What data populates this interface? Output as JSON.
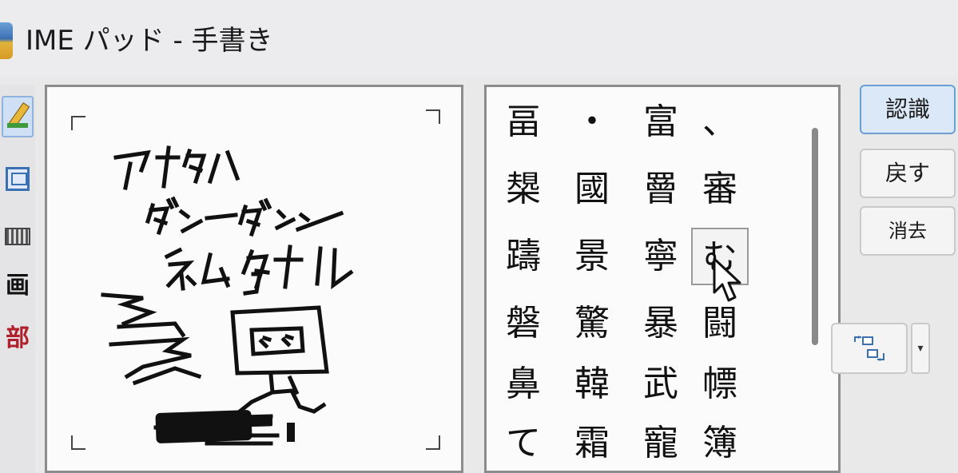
{
  "window": {
    "title": "IME パッド - 手書き"
  },
  "toolstrip": {
    "items": [
      {
        "name": "handwriting",
        "icon": "pencil-icon"
      },
      {
        "name": "soft-keyboard",
        "icon": "soft-keyboard-icon"
      },
      {
        "name": "keyboard",
        "icon": "keyboard-icon"
      },
      {
        "name": "stroke-count",
        "label": "画"
      },
      {
        "name": "radical",
        "label": "部"
      }
    ]
  },
  "candidates": {
    "rows": [
      [
        "畐",
        "・",
        "富",
        "、"
      ],
      [
        "槼",
        "國",
        "罾",
        "審"
      ],
      [
        "躊",
        "景",
        "寧",
        "む"
      ],
      [
        "磐",
        "驚",
        "暴",
        "闘"
      ],
      [
        "鼻",
        "韓",
        "武",
        "幖"
      ],
      [
        "て",
        "霜",
        "寵",
        "簿"
      ]
    ]
  },
  "buttons": {
    "recognize": "認識",
    "undo": "戻す",
    "clear": "消去"
  },
  "colors": {
    "accent": "#6b9fd4",
    "primary_button_bg": "#dbe8f7"
  }
}
